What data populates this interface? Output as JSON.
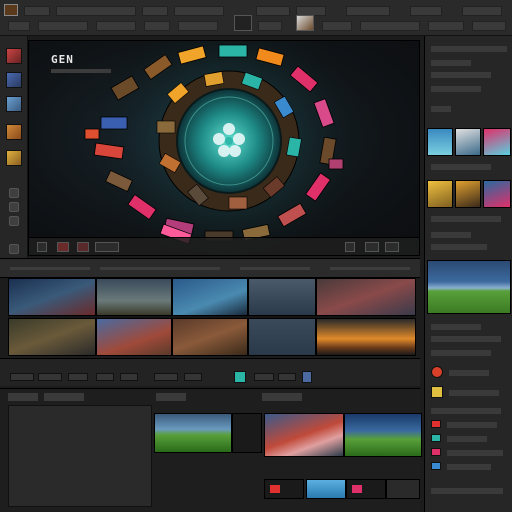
{
  "app": {
    "viewer_title": "GEN"
  },
  "colors": {
    "accent_teal": "#2bb5a7",
    "accent_orange": "#f08a1c",
    "accent_pink": "#e0306a",
    "panel_bg": "#262626"
  },
  "icons": {
    "viewer_center": "flower-icon",
    "topbar_left": "app-logo-icon",
    "search": "search-icon"
  }
}
